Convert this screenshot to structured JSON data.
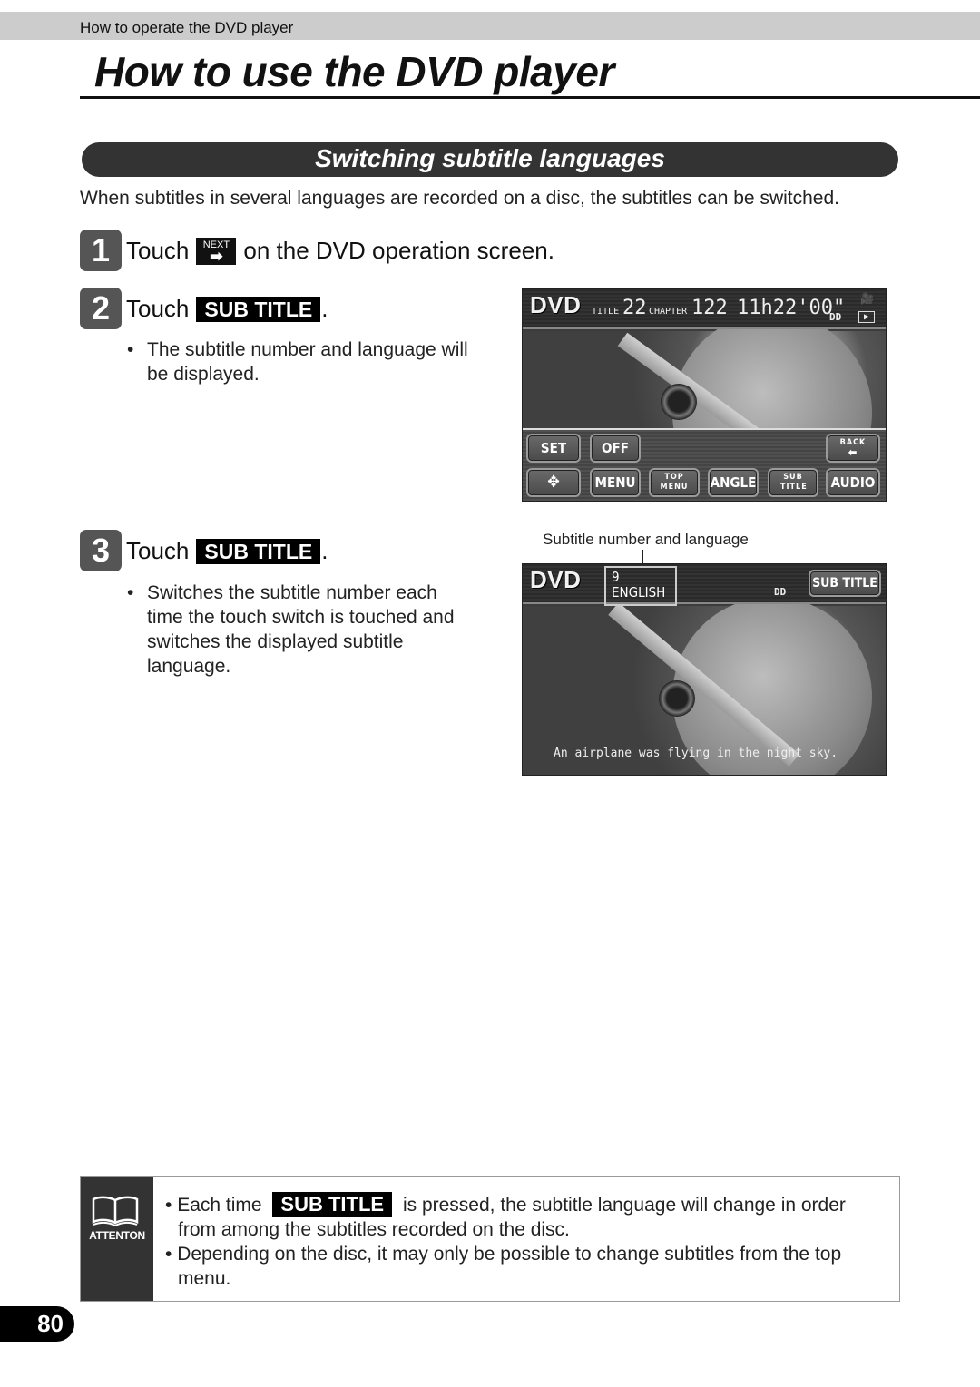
{
  "header": {
    "breadcrumb": "How to operate the DVD player",
    "title": "How to use the DVD player"
  },
  "section": {
    "title": "Switching subtitle languages",
    "intro": "When subtitles in several languages are recorded on a disc, the subtitles can be switched."
  },
  "steps": [
    {
      "number": "1",
      "prefix": "Touch",
      "icon": {
        "name": "next-icon",
        "label": "NEXT",
        "glyph": "➡"
      },
      "suffix": "on the DVD operation screen."
    },
    {
      "number": "2",
      "prefix": "Touch",
      "key": "SUB TITLE",
      "suffix": ".",
      "bullets": [
        "The subtitle number and language will",
        "be displayed."
      ]
    },
    {
      "number": "3",
      "prefix": "Touch",
      "key": "SUB TITLE",
      "suffix": ".",
      "bullets": [
        "Switches the subtitle number each",
        "time the touch switch is touched and",
        "switches the displayed subtitle",
        "language."
      ]
    }
  ],
  "screen1": {
    "logo": "DVD",
    "title_label": "TITLE",
    "title_value": "22",
    "chapter_label": "CHAPTER",
    "chapter_value": "122",
    "time": "11h22'00\"",
    "dolby": "DD",
    "play_glyph": "▶",
    "camera_glyph": "🎥",
    "buttons_row1": [
      "SET",
      "OFF"
    ],
    "back_label": "BACK",
    "back_glyph": "⬅",
    "buttons_row2": [
      "✥",
      "MENU",
      "TOP MENU",
      "ANGLE",
      "SUB TITLE",
      "AUDIO"
    ]
  },
  "screen2": {
    "callout": "Subtitle number and language",
    "logo": "DVD",
    "subtitle_number": "9",
    "subtitle_language": "ENGLISH",
    "dolby": "DD",
    "sub_title_button": "SUB TITLE",
    "caption": "An airplane was flying in the night sky."
  },
  "attention": {
    "label": "ATTENTON",
    "line1_before": "Each time",
    "line1_key": "SUB TITLE",
    "line1_after": "is pressed, the subtitle language will change in order",
    "line2": "from among the subtitles recorded on the disc.",
    "line3": "Depending on the disc, it may only be possible to change subtitles from the top",
    "line4": "menu.",
    "bullet": "•"
  },
  "page_number": "80"
}
